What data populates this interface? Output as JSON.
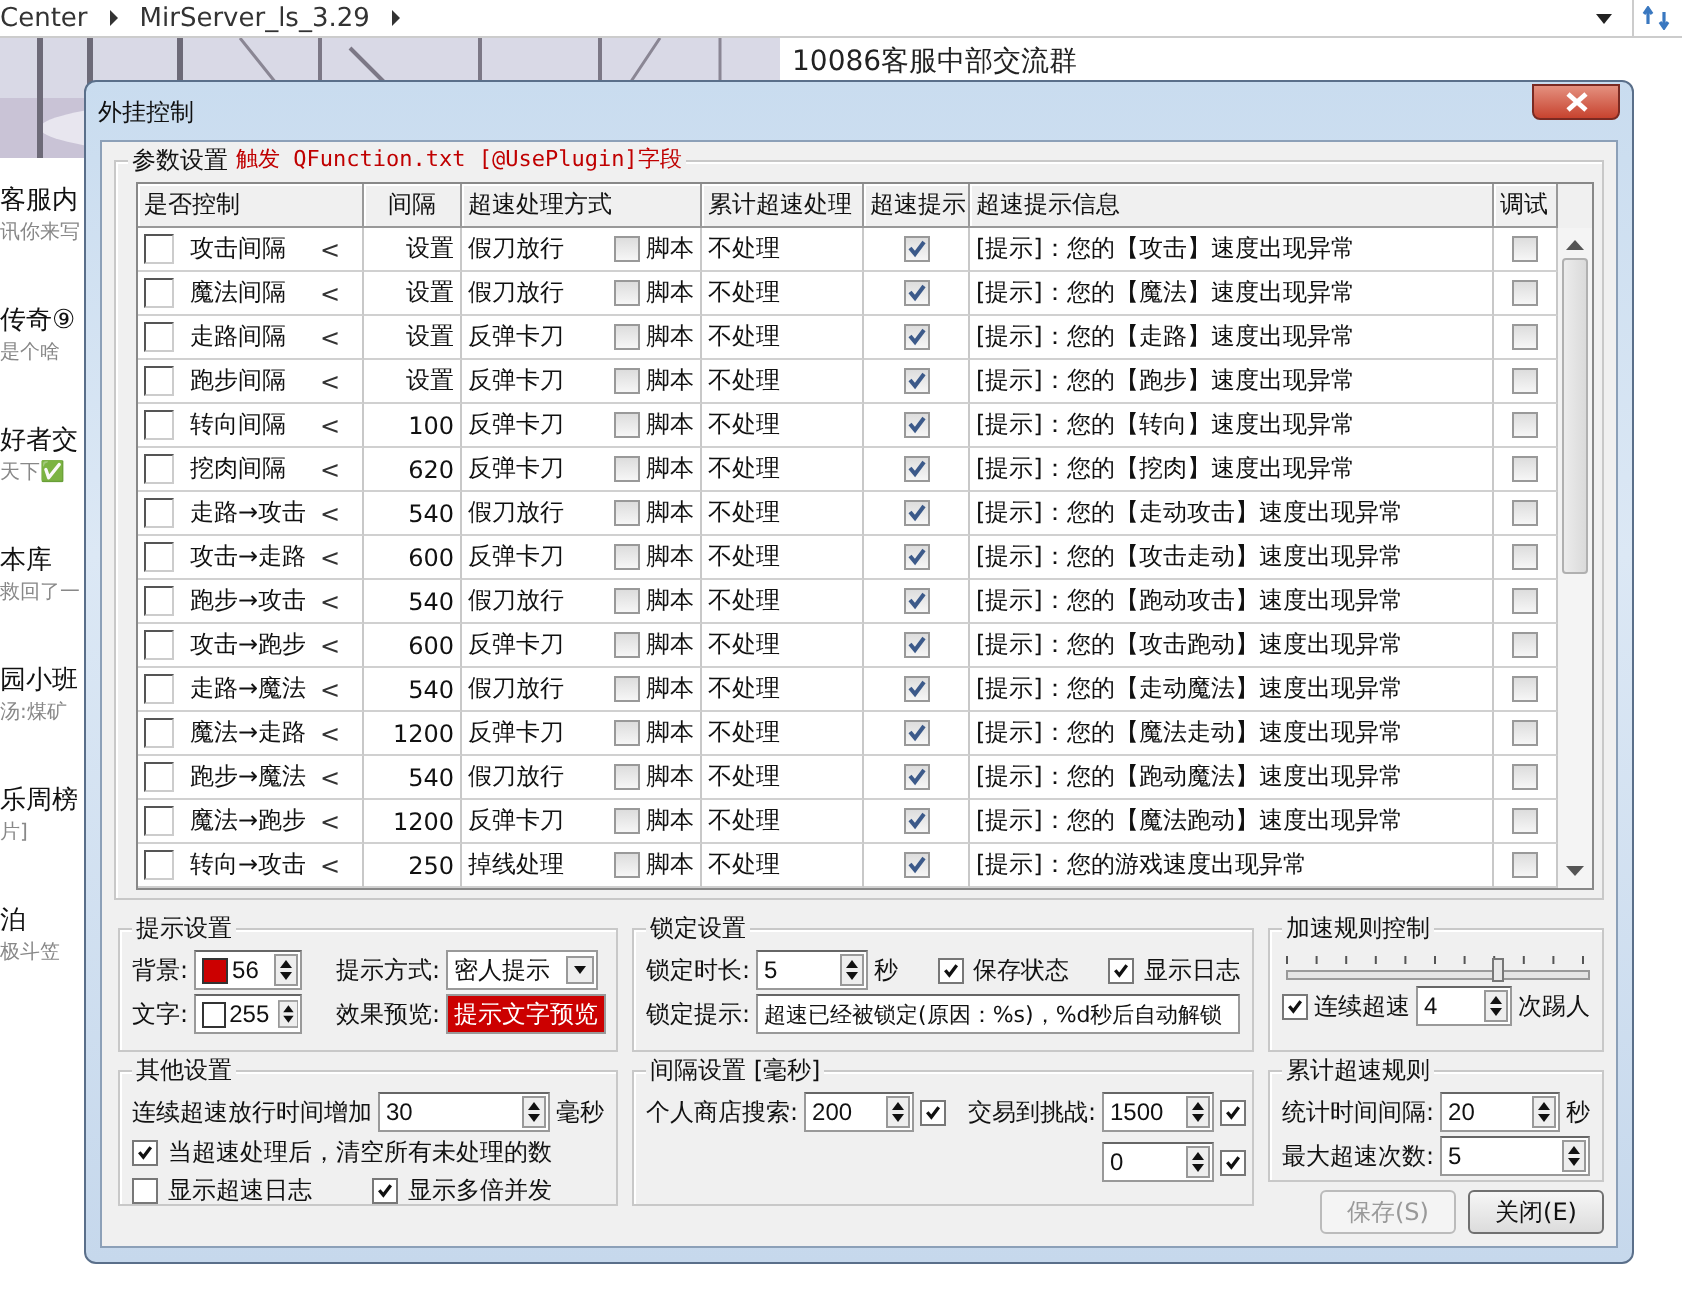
{
  "background": {
    "breadcrumb": [
      "Center",
      "MirServer_ls_3.29"
    ],
    "chat_title": "10086客服中部交流群",
    "chat_items": [
      {
        "name": "客服内",
        "preview": "讯你来写"
      },
      {
        "name": "传奇⑨",
        "preview": "是个啥"
      },
      {
        "name": "好者交",
        "preview": "天下✅"
      },
      {
        "name": "本库",
        "preview": "救回了一"
      },
      {
        "name": "园小班",
        "preview": "汤:煤矿"
      },
      {
        "name": "乐周榜",
        "preview": "片]"
      },
      {
        "name": "泊",
        "preview": "极斗笠"
      }
    ]
  },
  "dialog": {
    "title": "外挂控制"
  },
  "params_group": {
    "title": "参数设置",
    "trigger_note": "触发 QFunction.txt [@UsePlugin]字段"
  },
  "table": {
    "columns": [
      "是否控制",
      "间隔",
      "超速处理方式",
      "累计超速处理",
      "超速提示",
      "超速提示信息",
      "调试"
    ],
    "rows": [
      {
        "control": false,
        "action": "攻击间隔",
        "operator": "<",
        "interval": "设置",
        "mode": "假刀放行",
        "script": false,
        "script_label": "脚本",
        "cumulative": "不处理",
        "notify": true,
        "message": "[提示]：您的【攻击】速度出现异常",
        "debug": false
      },
      {
        "control": false,
        "action": "魔法间隔",
        "operator": "<",
        "interval": "设置",
        "mode": "假刀放行",
        "script": false,
        "script_label": "脚本",
        "cumulative": "不处理",
        "notify": true,
        "message": "[提示]：您的【魔法】速度出现异常",
        "debug": false
      },
      {
        "control": false,
        "action": "走路间隔",
        "operator": "<",
        "interval": "设置",
        "mode": "反弹卡刀",
        "script": false,
        "script_label": "脚本",
        "cumulative": "不处理",
        "notify": true,
        "message": "[提示]：您的【走路】速度出现异常",
        "debug": false
      },
      {
        "control": false,
        "action": "跑步间隔",
        "operator": "<",
        "interval": "设置",
        "mode": "反弹卡刀",
        "script": false,
        "script_label": "脚本",
        "cumulative": "不处理",
        "notify": true,
        "message": "[提示]：您的【跑步】速度出现异常",
        "debug": false
      },
      {
        "control": false,
        "action": "转向间隔",
        "operator": "<",
        "interval": "100",
        "mode": "反弹卡刀",
        "script": false,
        "script_label": "脚本",
        "cumulative": "不处理",
        "notify": true,
        "message": "[提示]：您的【转向】速度出现异常",
        "debug": false
      },
      {
        "control": false,
        "action": "挖肉间隔",
        "operator": "<",
        "interval": "620",
        "mode": "反弹卡刀",
        "script": false,
        "script_label": "脚本",
        "cumulative": "不处理",
        "notify": true,
        "message": "[提示]：您的【挖肉】速度出现异常",
        "debug": false
      },
      {
        "control": false,
        "action": "走路→攻击",
        "operator": "<",
        "interval": "540",
        "mode": "假刀放行",
        "script": false,
        "script_label": "脚本",
        "cumulative": "不处理",
        "notify": true,
        "message": "[提示]：您的【走动攻击】速度出现异常",
        "debug": false
      },
      {
        "control": false,
        "action": "攻击→走路",
        "operator": "<",
        "interval": "600",
        "mode": "反弹卡刀",
        "script": false,
        "script_label": "脚本",
        "cumulative": "不处理",
        "notify": true,
        "message": "[提示]：您的【攻击走动】速度出现异常",
        "debug": false
      },
      {
        "control": false,
        "action": "跑步→攻击",
        "operator": "<",
        "interval": "540",
        "mode": "假刀放行",
        "script": false,
        "script_label": "脚本",
        "cumulative": "不处理",
        "notify": true,
        "message": "[提示]：您的【跑动攻击】速度出现异常",
        "debug": false
      },
      {
        "control": false,
        "action": "攻击→跑步",
        "operator": "<",
        "interval": "600",
        "mode": "反弹卡刀",
        "script": false,
        "script_label": "脚本",
        "cumulative": "不处理",
        "notify": true,
        "message": "[提示]：您的【攻击跑动】速度出现异常",
        "debug": false
      },
      {
        "control": false,
        "action": "走路→魔法",
        "operator": "<",
        "interval": "540",
        "mode": "假刀放行",
        "script": false,
        "script_label": "脚本",
        "cumulative": "不处理",
        "notify": true,
        "message": "[提示]：您的【走动魔法】速度出现异常",
        "debug": false
      },
      {
        "control": false,
        "action": "魔法→走路",
        "operator": "<",
        "interval": "1200",
        "mode": "反弹卡刀",
        "script": false,
        "script_label": "脚本",
        "cumulative": "不处理",
        "notify": true,
        "message": "[提示]：您的【魔法走动】速度出现异常",
        "debug": false
      },
      {
        "control": false,
        "action": "跑步→魔法",
        "operator": "<",
        "interval": "540",
        "mode": "假刀放行",
        "script": false,
        "script_label": "脚本",
        "cumulative": "不处理",
        "notify": true,
        "message": "[提示]：您的【跑动魔法】速度出现异常",
        "debug": false
      },
      {
        "control": false,
        "action": "魔法→跑步",
        "operator": "<",
        "interval": "1200",
        "mode": "反弹卡刀",
        "script": false,
        "script_label": "脚本",
        "cumulative": "不处理",
        "notify": true,
        "message": "[提示]：您的【魔法跑动】速度出现异常",
        "debug": false
      },
      {
        "control": false,
        "action": "转向→攻击",
        "operator": "<",
        "interval": "250",
        "mode": "掉线处理",
        "script": false,
        "script_label": "脚本",
        "cumulative": "不处理",
        "notify": true,
        "message": "[提示]：您的游戏速度出现异常",
        "debug": false
      }
    ]
  },
  "hint_settings": {
    "title": "提示设置",
    "background": {
      "label": "背景:",
      "color": "#cc0000",
      "value": "56"
    },
    "text": {
      "label": "文字:",
      "color": "#ffffff",
      "value": "255"
    },
    "mode": {
      "label": "提示方式:",
      "value": "密人提示"
    },
    "preview": {
      "label": "效果预览:",
      "text": "提示文字预览"
    }
  },
  "lock_settings": {
    "title": "锁定设置",
    "duration": {
      "label": "锁定时长:",
      "value": "5",
      "unit": "秒"
    },
    "save_state": {
      "label": "保存状态",
      "checked": true
    },
    "show_log": {
      "label": "显示日志",
      "checked": true
    },
    "message": {
      "label": "锁定提示:",
      "value": "超速已经被锁定(原因：%s)，%d秒后自动解锁"
    }
  },
  "speed_rule": {
    "title": "加速规则控制",
    "level": 0.7,
    "consecutive": {
      "label": "连续超速",
      "checked": true,
      "value": "4",
      "unit": "次踢人"
    }
  },
  "other_settings": {
    "title": "其他设置",
    "increase": {
      "label": "连续超速放行时间增加",
      "value": "30",
      "unit": "毫秒"
    },
    "options": [
      {
        "label": "当超速处理后，清空所有未处理的数",
        "checked": true
      },
      {
        "label": "显示超速日志",
        "checked": false
      },
      {
        "label": "显示多倍并发",
        "checked": true
      }
    ]
  },
  "interval_settings": {
    "title": "间隔设置 [毫秒]",
    "items": [
      {
        "label": "个人商店搜索:",
        "value": "200",
        "checked": true
      },
      {
        "label": "交易到挑战:",
        "value": "1500",
        "checked": true
      },
      {
        "value": "0",
        "checked": true
      }
    ]
  },
  "cumulative_rule": {
    "title": "累计超速规则",
    "interval": {
      "label": "统计时间间隔:",
      "value": "20",
      "unit": "秒"
    },
    "max": {
      "label": "最大超速次数:",
      "value": "5"
    }
  },
  "buttons": [
    {
      "label": "保存(S)",
      "disabled": true
    },
    {
      "label": "关闭(E)",
      "disabled": false
    }
  ]
}
